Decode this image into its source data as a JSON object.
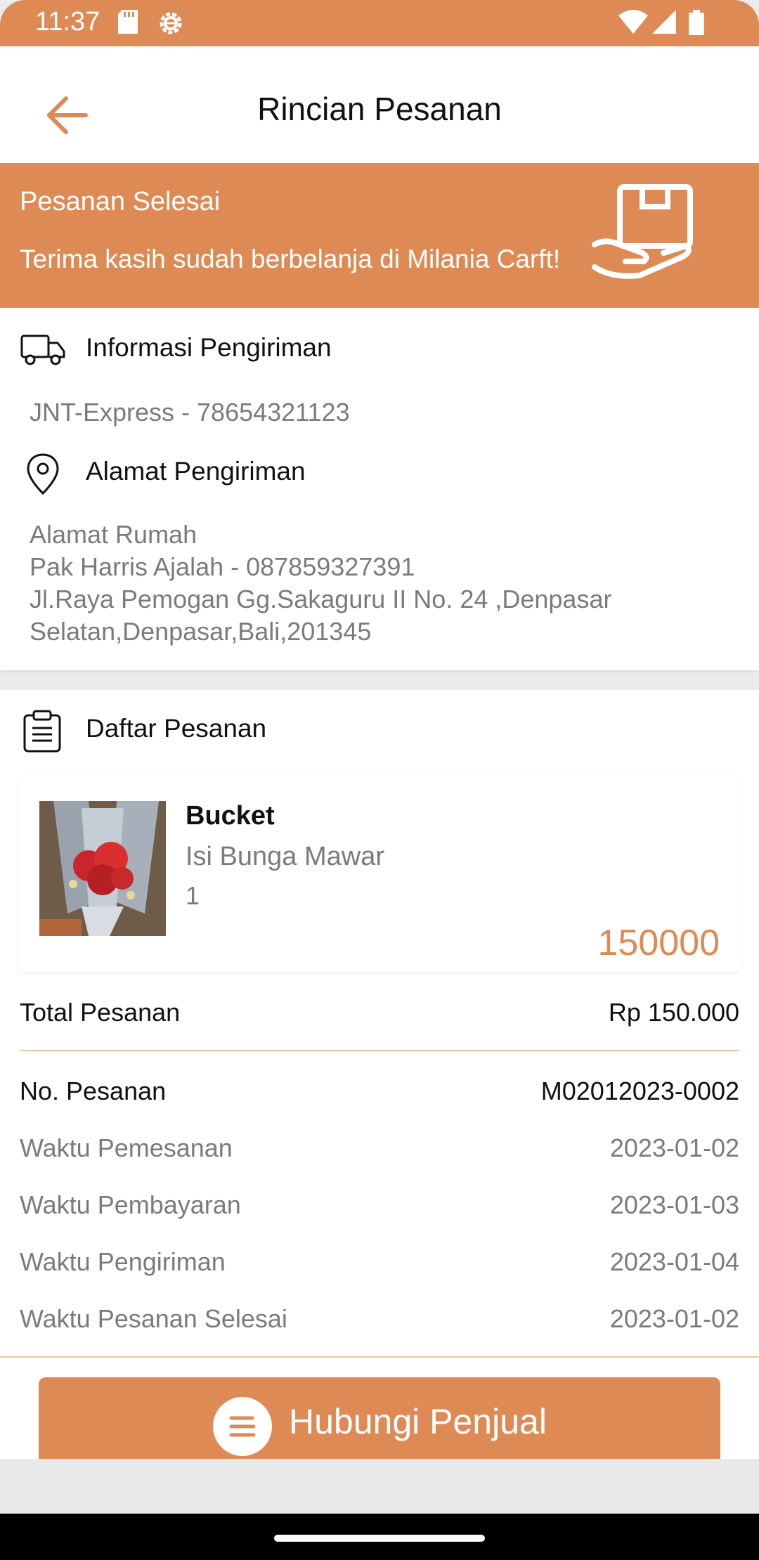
{
  "status_bar": {
    "time": "11:37",
    "icons": [
      "sd-card-icon",
      "settings-icon",
      "wifi-icon",
      "signal-icon",
      "battery-icon"
    ]
  },
  "app_bar": {
    "title": "Rincian Pesanan",
    "back_icon": "arrow-left-icon"
  },
  "banner": {
    "title": "Pesanan Selesai",
    "subtitle": "Terima kasih sudah berbelanja di Milania Carft!",
    "icon": "hand-package-icon"
  },
  "shipping_info": {
    "label": "Informasi Pengiriman",
    "icon": "truck-icon",
    "courier": "JNT-Express - 78654321123"
  },
  "address": {
    "label": "Alamat Pengiriman",
    "icon": "location-pin-icon",
    "type": "Alamat Rumah",
    "recipient": "Pak Harris Ajalah - 087859327391",
    "line1": "Jl.Raya Pemogan Gg.Sakaguru II No. 24 ,Denpasar",
    "line2": "Selatan,Denpasar,Bali,201345"
  },
  "order_list": {
    "label": "Daftar Pesanan",
    "icon": "clipboard-icon",
    "items": [
      {
        "name": "Bucket",
        "description": "Isi Bunga Mawar",
        "quantity": "1",
        "price": "150000"
      }
    ]
  },
  "summary": {
    "total_label": "Total Pesanan",
    "total_value": "Rp 150.000",
    "order_no_label": "No. Pesanan",
    "order_no_value": "M02012023-0002",
    "rows": [
      {
        "label": "Waktu Pemesanan",
        "value": "2023-01-02"
      },
      {
        "label": "Waktu Pembayaran",
        "value": "2023-01-03"
      },
      {
        "label": "Waktu Pengiriman",
        "value": "2023-01-04"
      },
      {
        "label": "Waktu Pesanan Selesai",
        "value": "2023-01-02"
      }
    ]
  },
  "contact_button": {
    "label": "Hubungi Penjual",
    "icon": "chat-icon"
  },
  "colors": {
    "accent": "#de8a55",
    "divider": "#f1c39f"
  }
}
